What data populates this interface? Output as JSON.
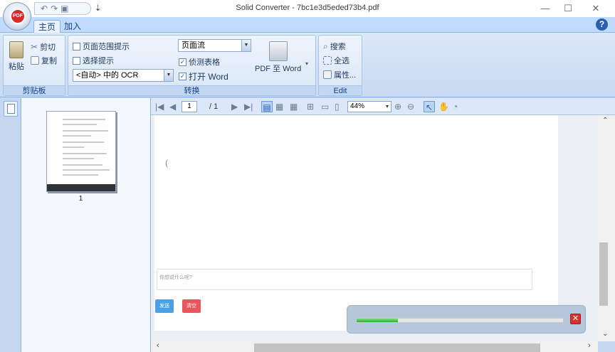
{
  "window": {
    "title": "Solid Converter - 7bc1e3d5eded73b4.pdf",
    "minimize": "—",
    "maximize": "☐",
    "close": "✕"
  },
  "quick_access": {
    "undo": "↶",
    "redo": "↷",
    "save": "▣",
    "more": "⇣"
  },
  "tabs": [
    {
      "label": "主页",
      "active": true
    },
    {
      "label": "加入",
      "active": false
    }
  ],
  "help": "?",
  "ribbon": {
    "clipboard": {
      "label": "剪贴板",
      "paste": "粘贴",
      "cut": "剪切",
      "copy": "复制"
    },
    "convert": {
      "label": "转换",
      "page_range_tip": {
        "label": "页面范围提示",
        "checked": false
      },
      "selection_tip": {
        "label": "选择提示",
        "checked": false
      },
      "ocr_select": "<自动> 中的 OCR",
      "layout_select": "页面流",
      "detect_tables": {
        "label": "侦测表格",
        "checked": true
      },
      "open_word": {
        "label": "打开 Word",
        "checked": true
      },
      "pdf_to_word": "PDF 至 Word"
    },
    "edit": {
      "label": "Edit",
      "search": "搜索",
      "select_all": "全选",
      "properties": "属性..."
    }
  },
  "viewer": {
    "page_current": "1",
    "page_total": "/ 1",
    "zoom": "44%"
  },
  "thumbnail": {
    "page_number": "1"
  },
  "document": {
    "caret": "(",
    "input_placeholder": "你想说什么呢?",
    "send_button": "发送",
    "clear_button": "清空"
  },
  "progress": {
    "value": 0.2
  },
  "colors": {
    "send_button": "#49a1e8",
    "clear_button": "#e8555c",
    "progress_fill": "#2eae2e"
  }
}
